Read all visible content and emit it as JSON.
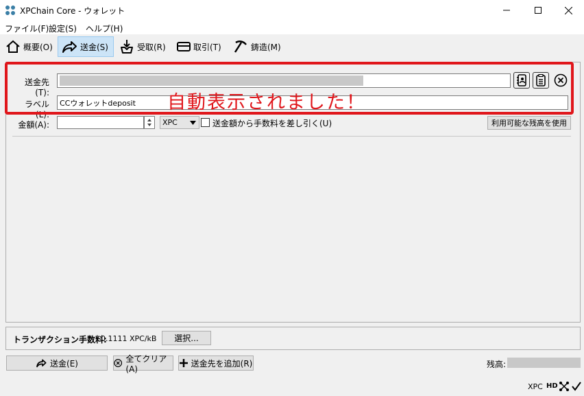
{
  "window": {
    "title": "XPChain Core - ウォレット"
  },
  "menu": [
    {
      "label": "ファイル(F)"
    },
    {
      "label": "設定(S)"
    },
    {
      "label": "ヘルプ(H)"
    }
  ],
  "toolbar": {
    "overview": "概要(O)",
    "send": "送金(S)",
    "receive": "受取(R)",
    "transactions": "取引(T)",
    "mint": "鋳造(M)"
  },
  "send_form": {
    "pay_to_label": "送金先(T):",
    "pay_to_value": "",
    "label_label": "ラベル(L):",
    "label_value": "CCウォレットdeposit",
    "amount_label": "金額(A):",
    "amount_value": "",
    "unit": "XPC",
    "subtract_fee_label": "送金額から手数料を差し引く(U)",
    "subtract_fee_checked": false,
    "use_available_balance": "利用可能な残高を使用"
  },
  "annotation": "自動表示されました！",
  "fee": {
    "label": "トランザクション手数料:",
    "value": "0.1111 XPC/kB",
    "choose_button": "選択..."
  },
  "actions": {
    "send": "送金(E)",
    "clear_all": "全てクリア(A)",
    "add_recipient": "送金先を追加(R)"
  },
  "balance": {
    "label": "残高:",
    "value": ""
  },
  "status": {
    "unit": "XPC",
    "hd": "HD"
  },
  "colors": {
    "highlight": "#e0161b",
    "active_tab": "#cce4f7"
  }
}
